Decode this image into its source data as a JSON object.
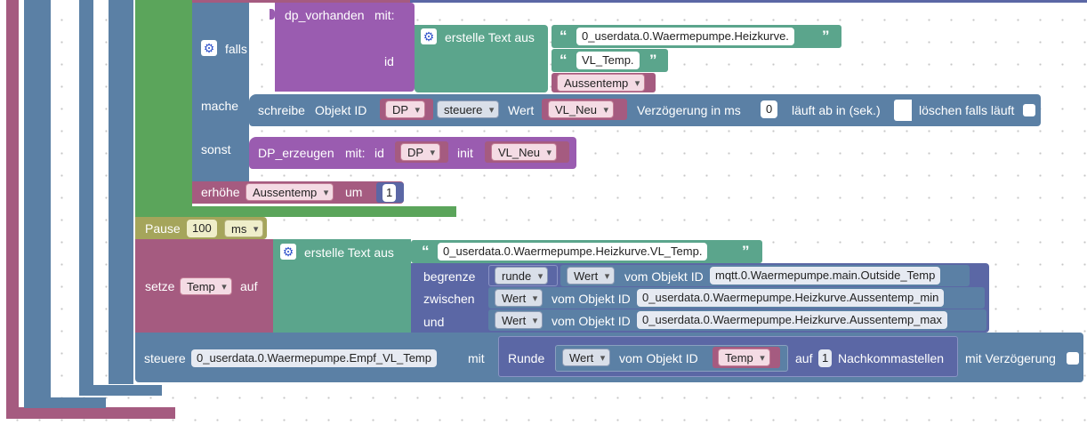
{
  "colors": {
    "procedure": "#a55b80",
    "loop": "#5b80a5",
    "logic": "#5ba55b",
    "dp_call": "#9a5cb0",
    "text": "#5ba58c",
    "io_object": "#5b80a5",
    "variable": "#a55b80",
    "timeouts": "#a5a55b",
    "math": "#5b67a5"
  },
  "blocks": {
    "if_block": {
      "if_label": "falls",
      "do_label": "mache",
      "else_label": "sonst",
      "gear_icon": "gear-icon"
    },
    "dp_exists": {
      "name": "dp_vorhanden",
      "with": "mit:",
      "id_label": "id"
    },
    "text_join_1": {
      "label": "erstelle Text aus",
      "item1": "0_userdata.0.Waermepumpe.Heizkurve.",
      "item2": "VL_Temp.",
      "item3_var": "Aussentemp",
      "quote_open": "“",
      "quote_close": "”"
    },
    "write_block": {
      "label_write": "schreibe",
      "label_object_id": "Objekt ID",
      "var_dp": "DP",
      "mode": "steuere",
      "label_value": "Wert",
      "var_value": "VL_Neu",
      "label_delay": "Verzögerung in ms",
      "delay": "0",
      "label_expire": "läuft ab in (sek.)",
      "label_clear": "löschen falls läuft"
    },
    "dp_create": {
      "name": "DP_erzeugen",
      "with": "mit:",
      "id_label": "id",
      "var_dp": "DP",
      "init_label": "init",
      "var_init": "VL_Neu"
    },
    "increment": {
      "label": "erhöhe",
      "var": "Aussentemp",
      "by_label": "um",
      "by": "1"
    },
    "pause": {
      "label": "Pause",
      "value": "100",
      "unit": "ms"
    },
    "set_var": {
      "label": "setze",
      "var": "Temp",
      "to_label": "auf"
    },
    "text_join_2": {
      "label": "erstelle Text aus",
      "item1": "0_userdata.0.Waermepumpe.Heizkurve.VL_Temp."
    },
    "constrain": {
      "label_constrain": "begrenze",
      "rounding": "runde",
      "value_label": "Wert",
      "of_object": "vom Objekt ID",
      "object1": "mqtt.0.Waermepumpe.main.Outside_Temp",
      "label_between": "zwischen",
      "object2": "0_userdata.0.Waermepumpe.Heizkurve.Aussentemp_min",
      "label_and": "und",
      "object3": "0_userdata.0.Waermepumpe.Heizkurve.Aussentemp_max"
    },
    "control": {
      "label": "steuere",
      "object": "0_userdata.0.Waermepumpe.Empf_VL_Temp",
      "with_label": "mit",
      "round_label": "Runde",
      "value_label": "Wert",
      "of_object": "vom Objekt ID",
      "var": "Temp",
      "to_label": "auf",
      "decimals": "1",
      "decimals_label": "Nachkommastellen",
      "delay_label": "mit Verzögerung"
    }
  }
}
